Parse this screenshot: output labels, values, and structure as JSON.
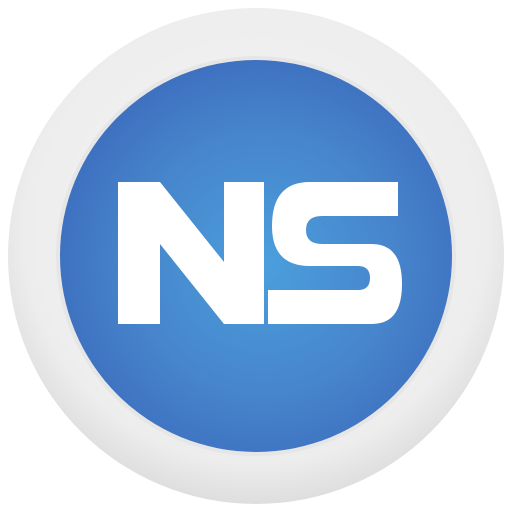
{
  "app_icon": {
    "name": "ns-app-icon",
    "logo_text": "NS",
    "colors": {
      "outer_ring": "#ececec",
      "outer_ring_edge": "#dcdcdc",
      "badge_center": "#4a9ad8",
      "badge_edge": "#3f6fbf",
      "glyph": "#ffffff"
    }
  }
}
